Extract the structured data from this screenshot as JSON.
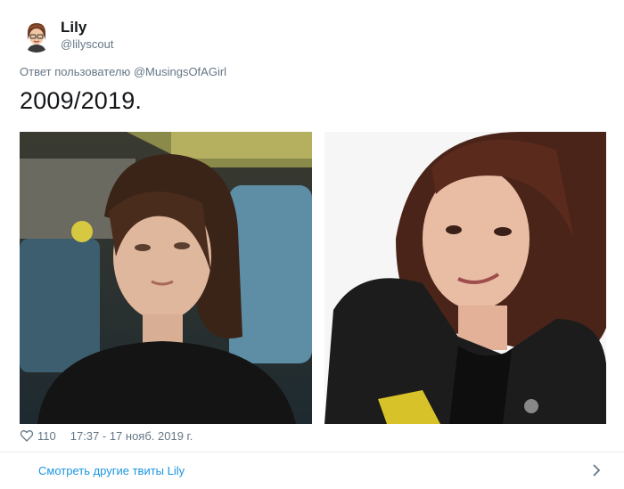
{
  "author": {
    "display_name": "Lily",
    "handle": "@lilyscout",
    "avatar_icon": "cartoon-avatar-icon"
  },
  "reply_context": "Ответ пользователю @MusingsOfAGirl",
  "tweet_text": "2009/2019.",
  "photos": [
    {
      "name": "photo-2009",
      "description_icon": "portrait-photo"
    },
    {
      "name": "photo-2019",
      "description_icon": "portrait-photo"
    }
  ],
  "meta": {
    "like_icon": "heart-icon",
    "like_count": "110",
    "timestamp": "17:37 - 17 нояб. 2019 г."
  },
  "footer": {
    "label": "Смотреть другие твиты Lily",
    "icon": "chevron-right-icon"
  },
  "colors": {
    "link_blue": "#1b95e0",
    "secondary_text": "#657786",
    "primary_text": "#14171a",
    "divider": "#e6ecf0"
  }
}
